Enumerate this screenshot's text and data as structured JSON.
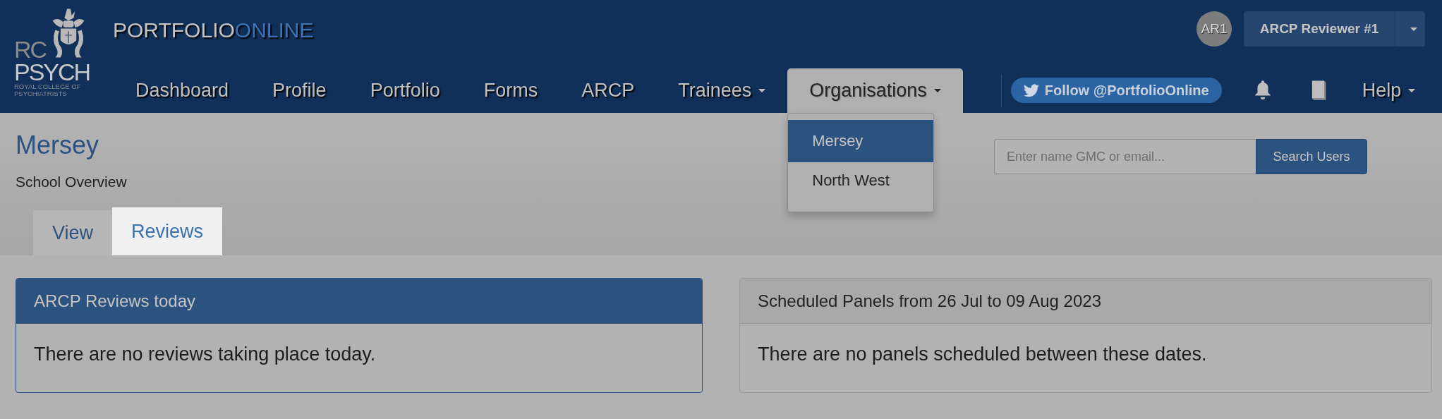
{
  "logo": {
    "lines": [
      "RC",
      "PSYCH",
      "ROYAL COLLEGE OF",
      "PSYCHIATRISTS"
    ]
  },
  "brand": {
    "primary": "PORTFOLIO",
    "accent": "ONLINE"
  },
  "user": {
    "avatar": "AR1",
    "name": "ARCP Reviewer #1"
  },
  "nav": [
    {
      "label": "Dashboard",
      "selected": false,
      "dropdown": false
    },
    {
      "label": "Profile",
      "selected": false,
      "dropdown": false
    },
    {
      "label": "Portfolio",
      "selected": false,
      "dropdown": false
    },
    {
      "label": "Forms",
      "selected": false,
      "dropdown": false
    },
    {
      "label": "ARCP",
      "selected": false,
      "dropdown": false
    },
    {
      "label": "Trainees",
      "selected": false,
      "dropdown": true
    },
    {
      "label": "Organisations",
      "selected": true,
      "dropdown": true
    }
  ],
  "twitter": {
    "label": "Follow @PortfolioOnline"
  },
  "help": {
    "label": "Help"
  },
  "org_menu": [
    {
      "label": "Mersey",
      "selected": true
    },
    {
      "label": "North West",
      "selected": false
    }
  ],
  "page": {
    "title": "Mersey",
    "subtitle": "School Overview"
  },
  "tabs": [
    {
      "label": "View",
      "selected": false
    },
    {
      "label": "Reviews",
      "selected": true
    }
  ],
  "search": {
    "placeholder": "Enter name GMC or email...",
    "button": "Search Users"
  },
  "panels": [
    {
      "kind": "primary",
      "title": "ARCP Reviews today",
      "message": "There are no reviews taking place today."
    },
    {
      "kind": "default",
      "title": "Scheduled Panels from 26 Jul to 09 Aug 2023",
      "message": "There are no panels scheduled between these dates."
    }
  ]
}
